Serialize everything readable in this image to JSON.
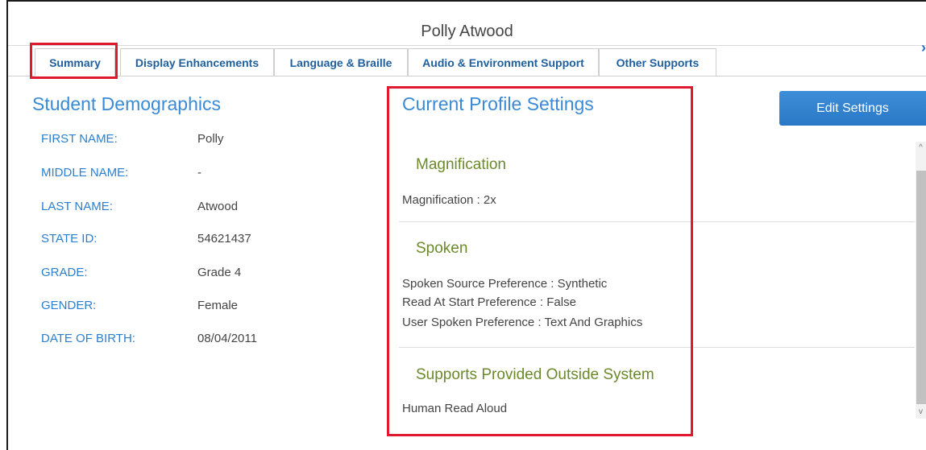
{
  "window": {
    "title": "Polly Atwood",
    "close_glyph": "›"
  },
  "tabs": [
    {
      "label": "Summary"
    },
    {
      "label": "Display Enhancements"
    },
    {
      "label": "Language & Braille"
    },
    {
      "label": "Audio & Environment Support"
    },
    {
      "label": "Other Supports"
    }
  ],
  "demographics": {
    "title": "Student Demographics",
    "rows": [
      {
        "label": "FIRST NAME:",
        "value": "Polly"
      },
      {
        "label": "MIDDLE NAME:",
        "value": "-"
      },
      {
        "label": "LAST NAME:",
        "value": "Atwood"
      },
      {
        "label": "STATE ID:",
        "value": "54621437"
      },
      {
        "label": "GRADE:",
        "value": "Grade 4"
      },
      {
        "label": "GENDER:",
        "value": "Female"
      },
      {
        "label": "DATE OF BIRTH:",
        "value": "08/04/2011"
      }
    ]
  },
  "profile": {
    "title": "Current Profile Settings",
    "edit_label": "Edit Settings",
    "sections": [
      {
        "title": "Magnification",
        "lines": [
          "Magnification : 2x"
        ]
      },
      {
        "title": "Spoken",
        "lines": [
          "Spoken Source Preference : Synthetic",
          "Read At Start Preference : False",
          "User Spoken Preference : Text And Graphics"
        ]
      },
      {
        "title": "Supports Provided Outside System",
        "lines": [
          "Human Read Aloud"
        ]
      }
    ]
  },
  "scrollbar": {
    "up_glyph": "^",
    "down_glyph": "v"
  }
}
